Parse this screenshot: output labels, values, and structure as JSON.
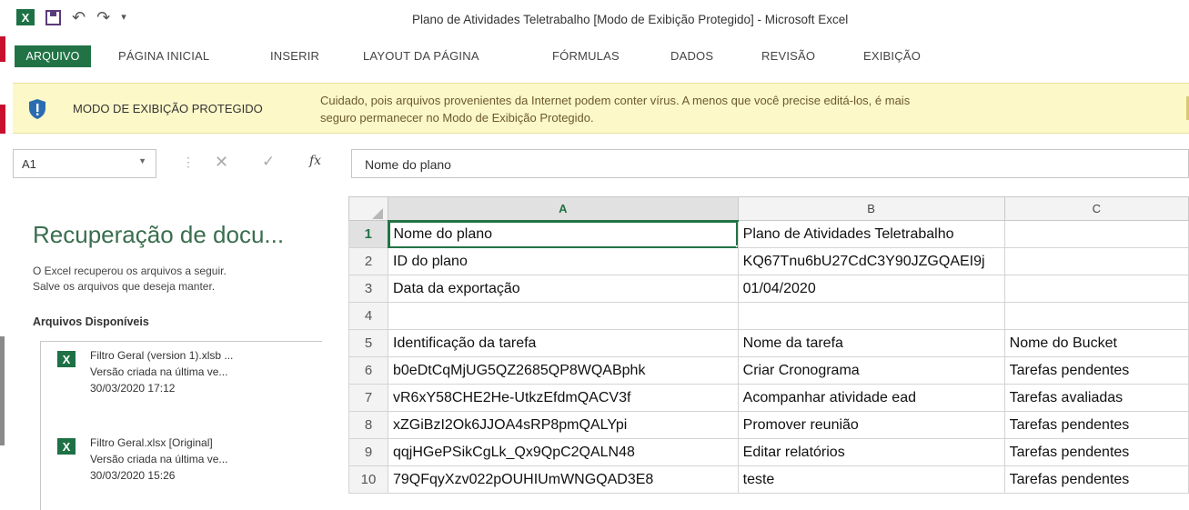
{
  "window": {
    "title": "Plano de Atividades Teletrabalho  [Modo de Exibição Protegido] - Microsoft Excel",
    "qat_undo_glyph": "↶",
    "qat_redo_glyph": "↷",
    "qat_more_glyph": "▾"
  },
  "ribbon": {
    "tabs": [
      "ARQUIVO",
      "PÁGINA INICIAL",
      "INSERIR",
      "LAYOUT DA PÁGINA",
      "FÓRMULAS",
      "DADOS",
      "REVISÃO",
      "EXIBIÇÃO"
    ],
    "active_tab": "ARQUIVO"
  },
  "protected_view": {
    "title": "MODO DE EXIBIÇÃO PROTEGIDO",
    "message_line1": "Cuidado, pois arquivos provenientes da Internet podem conter vírus. A menos que você precise editá-los, é mais",
    "message_line2": "seguro permanecer no Modo de  Exibição Protegido."
  },
  "formula_bar": {
    "name_box": "A1",
    "formula": "Nome do plano",
    "cancel_glyph": "✕",
    "enter_glyph": "✓",
    "fx_label": "fx"
  },
  "recovery": {
    "title": "Recuperação de docu...",
    "desc_line1": "O Excel recuperou os arquivos a seguir.",
    "desc_line2": "Salve os arquivos que deseja manter.",
    "files_heading": "Arquivos Disponíveis",
    "files": [
      {
        "name": "Filtro Geral (version 1).xlsb ...",
        "note": "Versão criada na última ve...",
        "date": "30/03/2020 17:12"
      },
      {
        "name": "Filtro Geral.xlsx  [Original]",
        "note": "Versão criada na última ve...",
        "date": "30/03/2020 15:26"
      }
    ]
  },
  "sheet": {
    "columns": [
      "A",
      "B",
      "C"
    ],
    "selected_cell": "A1",
    "rows": [
      {
        "n": "1",
        "a": "Nome do plano",
        "b": "Plano de Atividades Teletrabalho",
        "c": ""
      },
      {
        "n": "2",
        "a": "ID do plano",
        "b": "KQ67Tnu6bU27CdC3Y90JZGQAEI9j",
        "c": ""
      },
      {
        "n": "3",
        "a": "Data da exportação",
        "b": "01/04/2020",
        "c": ""
      },
      {
        "n": "4",
        "a": "",
        "b": "",
        "c": ""
      },
      {
        "n": "5",
        "a": "Identificação da tarefa",
        "b": "Nome da tarefa",
        "c": "Nome do Bucket"
      },
      {
        "n": "6",
        "a": "b0eDtCqMjUG5QZ2685QP8WQABphk",
        "b": "Criar Cronograma",
        "c": "Tarefas pendentes"
      },
      {
        "n": "7",
        "a": "vR6xY58CHE2He-UtkzEfdmQACV3f",
        "b": "Acompanhar atividade ead",
        "c": "Tarefas avaliadas"
      },
      {
        "n": "8",
        "a": "xZGiBzI2Ok6JJOA4sRP8pmQALYpi",
        "b": "Promover reunião",
        "c": "Tarefas pendentes"
      },
      {
        "n": "9",
        "a": "qqjHGePSikCgLk_Qx9QpC2QALN48",
        "b": "Editar relatórios",
        "c": "Tarefas pendentes"
      },
      {
        "n": "10",
        "a": "79QFqyXzv022pOUHIUmWNGQAD3E8",
        "b": "teste",
        "c": "Tarefas pendentes"
      }
    ]
  },
  "colors": {
    "excel_green": "#217346",
    "protected_bg": "#fcf8c8",
    "shield_blue": "#2b6cb0"
  }
}
